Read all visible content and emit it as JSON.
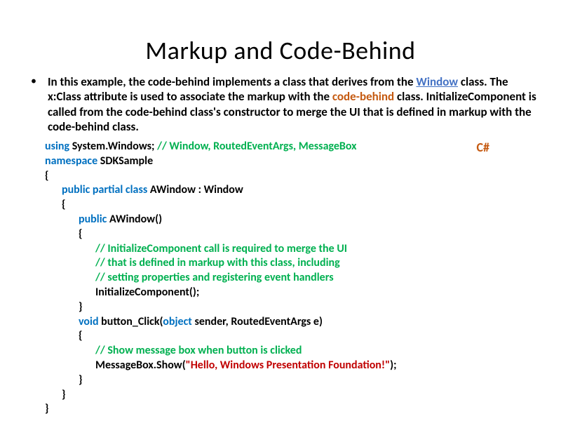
{
  "title": "Markup and Code-Behind",
  "bullet": "•",
  "description": {
    "p1": "In this example, the code-behind implements a class that derives from the ",
    "link1": "Window",
    "p2": " class. The ",
    "bold1": "x:Class",
    "p3": " attribute is used to associate the markup with the ",
    "orange1": "code-behind",
    "p4": " class. InitializeComponent is called from the code-behind class's constructor to merge the UI that is defined in markup with the code-behind class."
  },
  "langBadge": "C#",
  "code": {
    "l1a": "using ",
    "l1b": "System.Windows; ",
    "l1c": "// Window, RoutedEventArgs, MessageBox",
    "l2a": "namespace ",
    "l2b": "SDKSample",
    "l3": "{",
    "l4a": "public partial class ",
    "l4b": "AWindow : Window",
    "l5": "{",
    "l6a": "public ",
    "l6b": "AWindow()",
    "l7": "{",
    "l8": "// InitializeComponent call is required to merge the UI",
    "l9": "// that is defined in markup with this class, including",
    "l10": "// setting properties and registering event handlers",
    "l11": "InitializeComponent();",
    "l12": "}",
    "l13a": "void ",
    "l13b": "button_Click(",
    "l13c": "object ",
    "l13d": "sender, RoutedEventArgs e)",
    "l14": "{",
    "l15": "// Show message box when button is clicked",
    "l16a": "MessageBox.Show(",
    "l16b": "\"Hello, Windows Presentation Foundation!\"",
    "l16c": ");",
    "l17": "}",
    "l18": "}",
    "l19": "}"
  }
}
